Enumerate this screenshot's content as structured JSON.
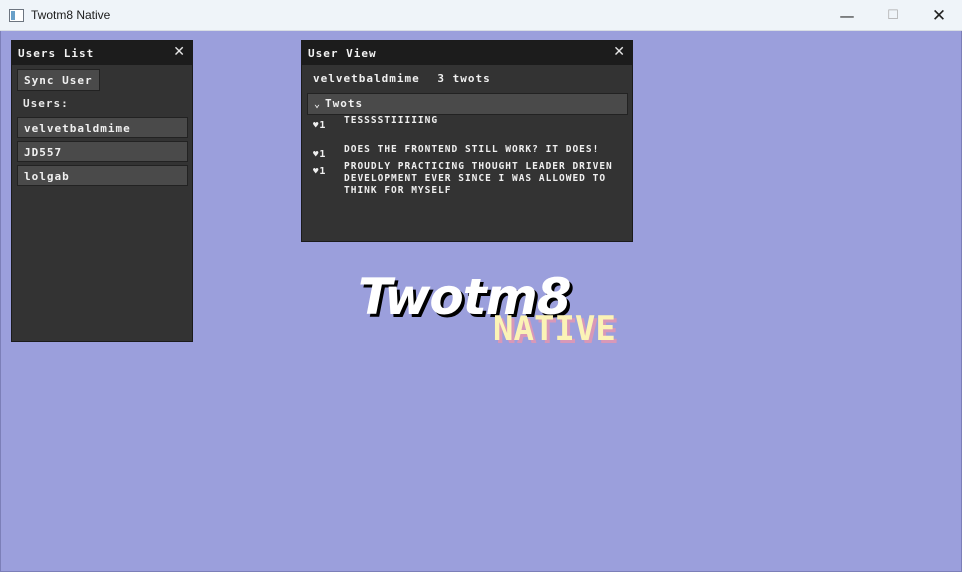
{
  "window": {
    "title": "Twotm8 Native",
    "minimize_glyph": "—",
    "maximize_glyph": "☐",
    "close_glyph": "✕"
  },
  "users_panel": {
    "title": "Users List",
    "close_glyph": "✕",
    "sync_button": "Sync User",
    "users_label": "Users:",
    "users": [
      "velvetbaldmime",
      "JD557",
      "lolgab"
    ]
  },
  "user_view": {
    "title": "User View",
    "close_glyph": "✕",
    "username": "velvetbaldmime",
    "twot_count": "3 twots",
    "section_label": "Twots",
    "twots": [
      {
        "likes": "1",
        "text": "TESSSSTIIIIING"
      },
      {
        "likes": "1",
        "text": "DOES THE FRONTEND STILL WORK? IT DOES!"
      },
      {
        "likes": "1",
        "text": "PROUDLY PRACTICING THOUGHT LEADER DRIVEN DEVELOPMENT EVER SINCE I WAS ALLOWED TO THINK FOR MYSELF"
      }
    ]
  },
  "logo": {
    "title": "Twotm8",
    "subtitle": "NATIVE"
  },
  "colors": {
    "background": "#9b9fdc",
    "panel": "#333333",
    "panel_header": "#1c1c1c",
    "logo_subtitle": "#fbf3b6"
  }
}
